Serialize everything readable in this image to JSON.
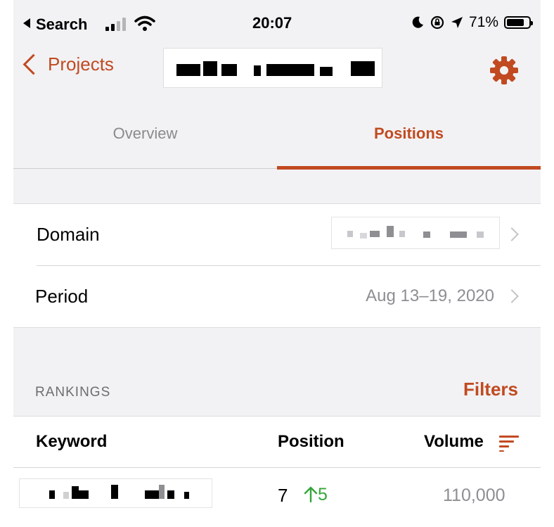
{
  "status_bar": {
    "back_app": "Search",
    "time": "20:07",
    "battery": "71%",
    "battery_level": 0.71
  },
  "nav": {
    "back_label": "Projects",
    "settings_icon": "gear-icon"
  },
  "tabs": [
    {
      "label": "Overview",
      "selected": false
    },
    {
      "label": "Positions",
      "selected": true
    }
  ],
  "filters_group": {
    "domain_label": "Domain",
    "period_label": "Period",
    "period_value": "Aug 13–19, 2020"
  },
  "rankings": {
    "section_title": "RANKINGS",
    "filters_button": "Filters",
    "columns": {
      "keyword": "Keyword",
      "position": "Position",
      "volume": "Volume"
    },
    "rows": [
      {
        "position": "7",
        "delta": "5",
        "volume": "110,000"
      }
    ]
  },
  "colors": {
    "accent": "#c14a21",
    "positive": "#34a63a",
    "secondary_text": "#8e8e93"
  }
}
